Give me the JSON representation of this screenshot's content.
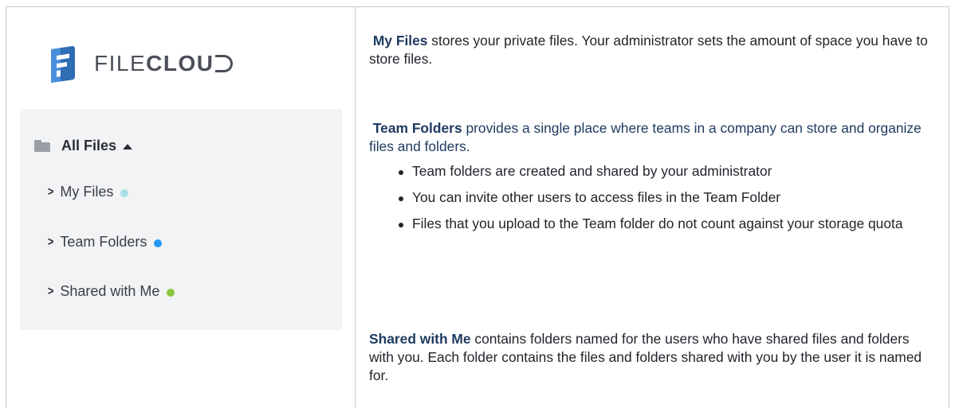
{
  "logo": {
    "part1": "FILE",
    "part2": "CLOU",
    "icon": "filecloud-logo-icon"
  },
  "tree": {
    "root_label": "All Files",
    "root_icon": "folder-icon",
    "items": [
      {
        "label": "My Files",
        "dot_color": "#a8e0e6"
      },
      {
        "label": "Team Folders",
        "dot_color": "#2196f3"
      },
      {
        "label": "Shared with Me",
        "dot_color": "#8cc63f"
      }
    ]
  },
  "descriptions": {
    "my_files": {
      "term": "My Files",
      "text": " stores your private files. Your administrator sets the amount of space you have to store files."
    },
    "team_folders": {
      "term": "Team Folders",
      "text": " provides a single place where teams in a company can store and organize files and folders.",
      "bullets": [
        "Team folders are created and shared by your administrator",
        "You can invite other users to access files in the Team Folder",
        "Files that you upload to the Team folder do not count against your storage quota"
      ]
    },
    "shared_with_me": {
      "term": "Shared with Me",
      "text": " contains folders named for the users who have shared files and folders with you. Each folder contains the files and folders shared with you by the user it is named for."
    }
  },
  "colors": {
    "accent_navy": "#1e3a5f",
    "logo_blue": "#2f6db5",
    "panel_bg": "#f2f3f4",
    "border": "#c8c8c8"
  }
}
